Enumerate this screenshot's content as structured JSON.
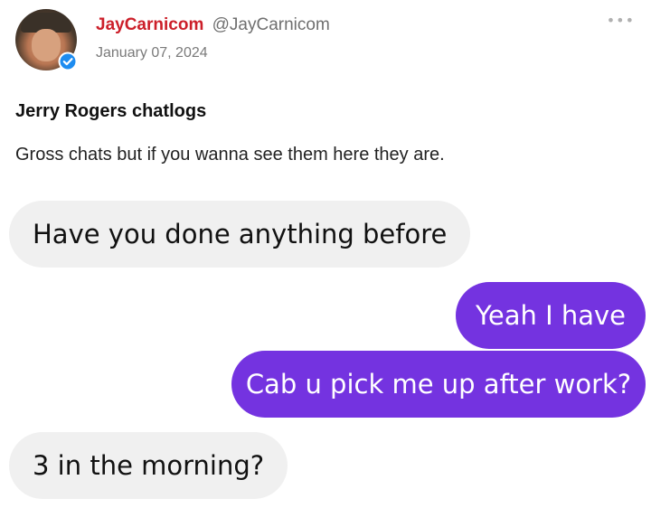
{
  "author": {
    "display_name": "JayCarnicom",
    "handle": "@JayCarnicom",
    "verified": true,
    "avatar_icon": "profile-photo",
    "verified_icon": "verified-check-icon"
  },
  "post": {
    "date": "January 07, 2024",
    "title": "Jerry Rogers chatlogs",
    "body": "Gross chats but if you wanna see them here they are.",
    "menu_icon": "more-options-icon"
  },
  "chat": {
    "messages": [
      {
        "direction": "incoming",
        "text": "Have you done anything before"
      },
      {
        "direction": "outgoing",
        "text": "Yeah I have"
      },
      {
        "direction": "outgoing",
        "text": "Cab u pick me up after work?"
      },
      {
        "direction": "incoming",
        "text": "3 in the morning?"
      }
    ]
  },
  "colors": {
    "author_name": "#cc1f2a",
    "incoming_bubble": "#f0f0f0",
    "outgoing_bubble": "#7433e0",
    "verified_badge": "#1d8cf0"
  }
}
